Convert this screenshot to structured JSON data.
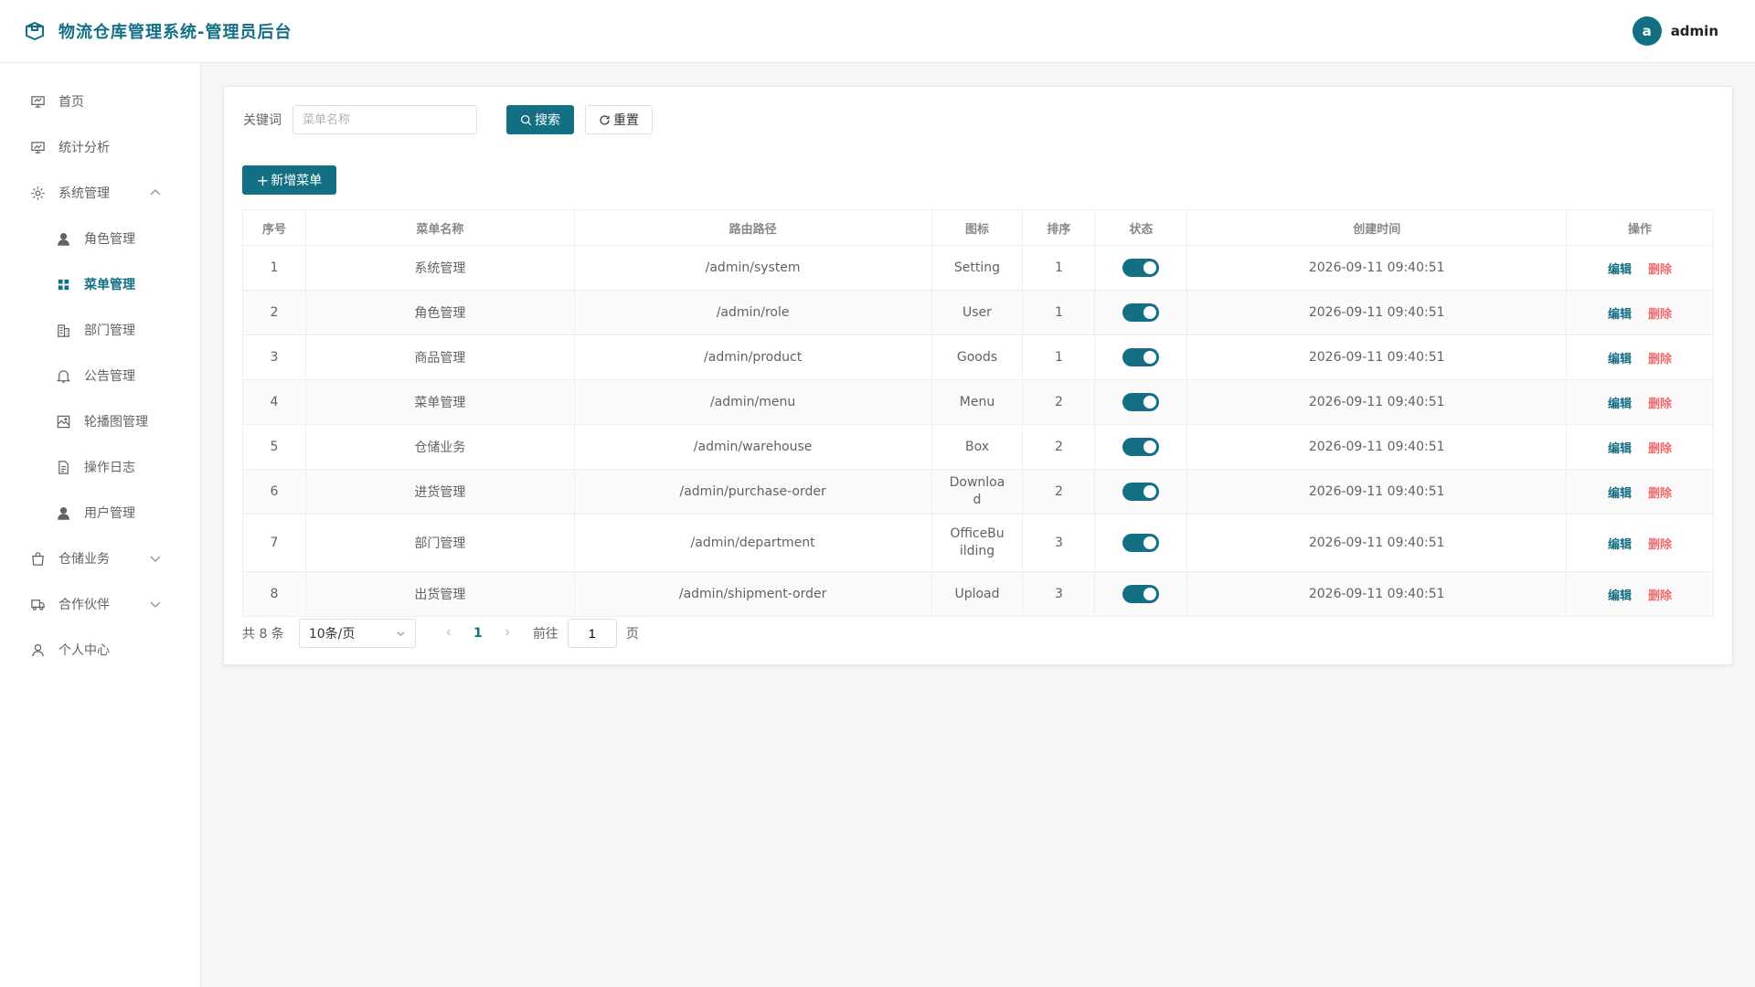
{
  "header": {
    "title": "物流仓库管理系统-管理员后台",
    "avatar_letter": "a",
    "username": "admin"
  },
  "sidebar": {
    "items": [
      {
        "label": "首页",
        "icon": "monitor-icon"
      },
      {
        "label": "统计分析",
        "icon": "chart-icon"
      },
      {
        "label": "系统管理",
        "icon": "gear-icon",
        "expanded": true
      },
      {
        "label": "角色管理",
        "icon": "user-icon",
        "sub": true
      },
      {
        "label": "菜单管理",
        "icon": "grid-icon",
        "sub": true,
        "active": true
      },
      {
        "label": "部门管理",
        "icon": "building-icon",
        "sub": true
      },
      {
        "label": "公告管理",
        "icon": "bell-icon",
        "sub": true
      },
      {
        "label": "轮播图管理",
        "icon": "picture-icon",
        "sub": true
      },
      {
        "label": "操作日志",
        "icon": "document-icon",
        "sub": true
      },
      {
        "label": "用户管理",
        "icon": "user-icon",
        "sub": true
      },
      {
        "label": "仓储业务",
        "icon": "bag-icon"
      },
      {
        "label": "合作伙伴",
        "icon": "truck-icon"
      },
      {
        "label": "个人中心",
        "icon": "person-icon"
      }
    ]
  },
  "search": {
    "label": "关键词",
    "placeholder": "菜单名称",
    "search_btn": "搜索",
    "reset_btn": "重置"
  },
  "add_btn": "新增菜单",
  "table": {
    "headers": [
      "序号",
      "菜单名称",
      "路由路径",
      "图标",
      "排序",
      "状态",
      "创建时间",
      "操作"
    ],
    "edit_label": "编辑",
    "delete_label": "删除",
    "rows": [
      {
        "id": "1",
        "name": "系统管理",
        "path": "/admin/system",
        "icon": "Setting",
        "sort": "1",
        "enabled": true,
        "created": "2026-09-11 09:40:51"
      },
      {
        "id": "2",
        "name": "角色管理",
        "path": "/admin/role",
        "icon": "User",
        "sort": "1",
        "enabled": true,
        "created": "2026-09-11 09:40:51"
      },
      {
        "id": "3",
        "name": "商品管理",
        "path": "/admin/product",
        "icon": "Goods",
        "sort": "1",
        "enabled": true,
        "created": "2026-09-11 09:40:51"
      },
      {
        "id": "4",
        "name": "菜单管理",
        "path": "/admin/menu",
        "icon": "Menu",
        "sort": "2",
        "enabled": true,
        "created": "2026-09-11 09:40:51"
      },
      {
        "id": "5",
        "name": "仓储业务",
        "path": "/admin/warehouse",
        "icon": "Box",
        "sort": "2",
        "enabled": true,
        "created": "2026-09-11 09:40:51"
      },
      {
        "id": "6",
        "name": "进货管理",
        "path": "/admin/purchase-order",
        "icon": "Download",
        "sort": "2",
        "enabled": true,
        "created": "2026-09-11 09:40:51"
      },
      {
        "id": "7",
        "name": "部门管理",
        "path": "/admin/department",
        "icon": "OfficeBuilding",
        "sort": "3",
        "enabled": true,
        "created": "2026-09-11 09:40:51"
      },
      {
        "id": "8",
        "name": "出货管理",
        "path": "/admin/shipment-order",
        "icon": "Upload",
        "sort": "3",
        "enabled": true,
        "created": "2026-09-11 09:40:51"
      }
    ]
  },
  "pagination": {
    "total_text": "共 8 条",
    "page_size": "10条/页",
    "current_page": "1",
    "goto_label": "前往",
    "goto_value": "1",
    "page_suffix": "页"
  },
  "colors": {
    "accent": "#136f84",
    "danger": "#f06b6b"
  }
}
